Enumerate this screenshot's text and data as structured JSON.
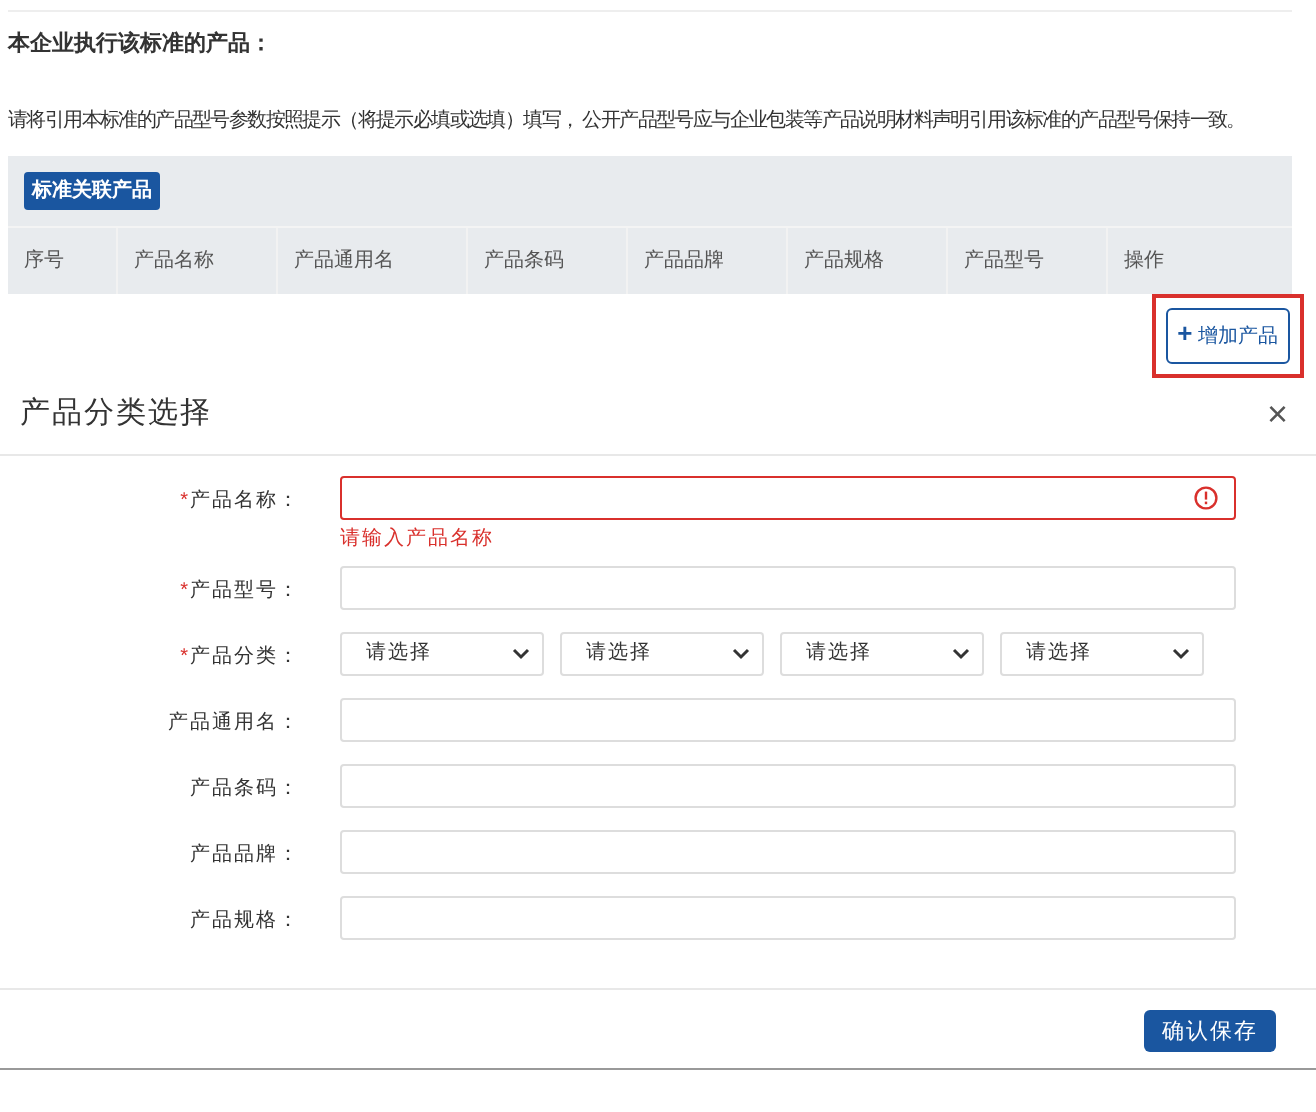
{
  "section": {
    "title": "本企业执行该标准的产品：",
    "description": "请将引用本标准的产品型号参数按照提示（将提示必填或选填）填写， 公开产品型号应与企业包装等产品说明材料声明引用该标准的产品型号保持一致。"
  },
  "table": {
    "badge": "标准关联产品",
    "columns": [
      "序号",
      "产品名称",
      "产品通用名",
      "产品条码",
      "产品品牌",
      "产品规格",
      "产品型号",
      "操作"
    ]
  },
  "add_button": {
    "icon": "+",
    "label": "增加产品",
    "highlighted": true
  },
  "dialog": {
    "title": "产品分类选择",
    "close": "×",
    "required_mark": "*",
    "fields": [
      {
        "kind": "text",
        "label": "产品名称：",
        "required": true,
        "error": "请输入产品名称"
      },
      {
        "kind": "text",
        "label": "产品型号：",
        "required": true
      },
      {
        "kind": "select",
        "label": "产品分类：",
        "required": true,
        "options": [
          "请选择",
          "请选择",
          "请选择",
          "请选择"
        ]
      },
      {
        "kind": "text",
        "label": "产品通用名：",
        "required": false
      },
      {
        "kind": "text",
        "label": "产品条码：",
        "required": false
      },
      {
        "kind": "text",
        "label": "产品品牌：",
        "required": false
      },
      {
        "kind": "text",
        "label": "产品规格：",
        "required": false
      }
    ],
    "save_button": "确认保存"
  }
}
